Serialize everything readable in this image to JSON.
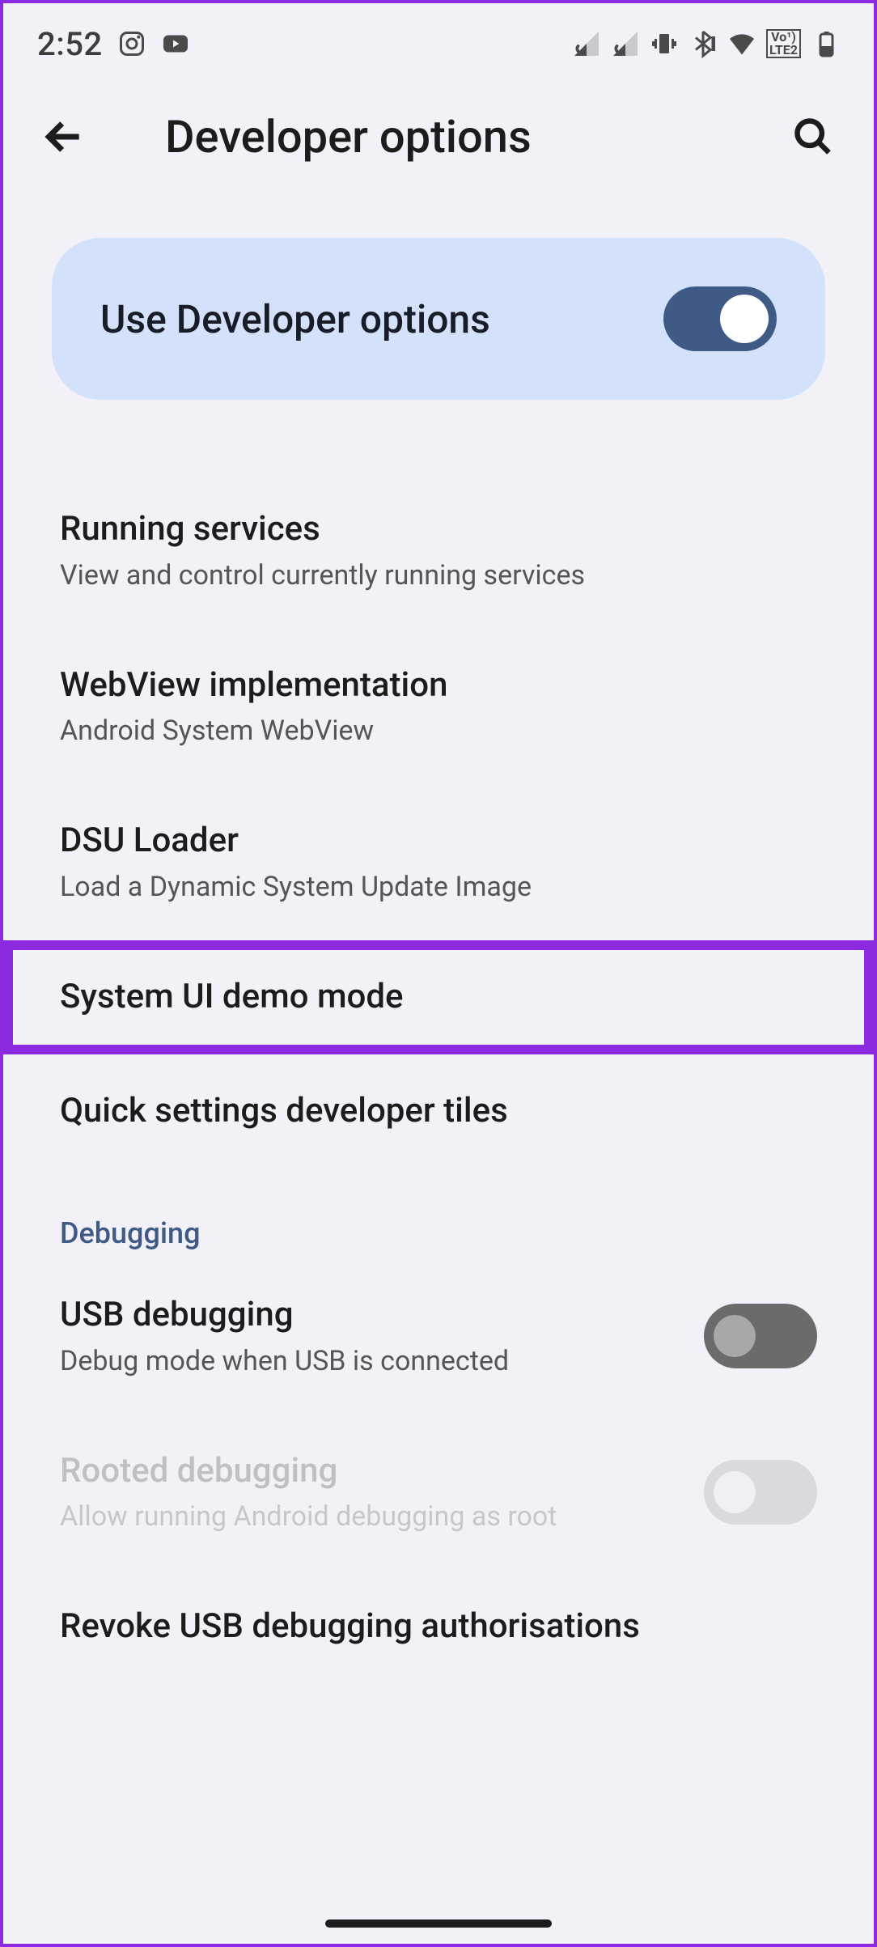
{
  "status": {
    "time": "2:52"
  },
  "header": {
    "title": "Developer options"
  },
  "master": {
    "label": "Use Developer options",
    "on": true
  },
  "sections": {
    "debugging_label": "Debugging"
  },
  "items": {
    "running_services": {
      "title": "Running services",
      "sub": "View and control currently running services"
    },
    "webview": {
      "title": "WebView implementation",
      "sub": "Android System WebView"
    },
    "dsu": {
      "title": "DSU Loader",
      "sub": "Load a Dynamic System Update Image"
    },
    "demo_mode": {
      "title": "System UI demo mode"
    },
    "qs_tiles": {
      "title": "Quick settings developer tiles"
    },
    "usb_debug": {
      "title": "USB debugging",
      "sub": "Debug mode when USB is connected",
      "on": false
    },
    "rooted_debug": {
      "title": "Rooted debugging",
      "sub": "Allow running Android debugging as root",
      "on": false
    },
    "revoke_usb": {
      "title": "Revoke USB debugging authorisations"
    }
  }
}
